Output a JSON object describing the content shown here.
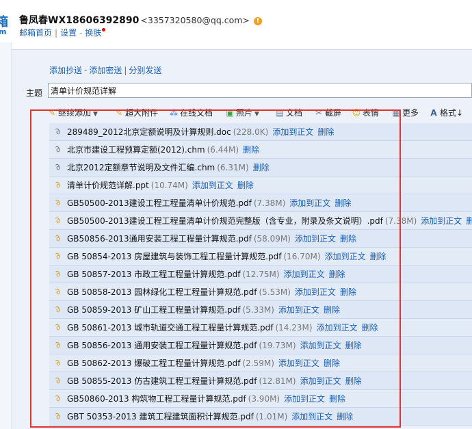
{
  "header": {
    "logo_fragment_top": "箱",
    "logo_fragment_bottom": "m",
    "user_name": "鲁凤春WX18606392890",
    "user_email": "<3357320580@qq.com>",
    "warn_symbol": "!",
    "nav": {
      "home": "邮箱首页",
      "settings": "设置",
      "sep": "-",
      "skin": "换肤"
    }
  },
  "compose": {
    "add_cc": "添加抄送",
    "add_bcc": "添加密送",
    "separate_send": "分别发送",
    "dash": "-",
    "pipe": "|",
    "subject_label": "主题",
    "subject_value": "清单计价规范详解"
  },
  "toolbar": {
    "items": [
      {
        "label": "继续添加",
        "icon": "paperclip-icon"
      },
      {
        "label": "超大附件",
        "icon": "paperclip-icon"
      },
      {
        "label": "在线文档",
        "icon": "share-icon"
      },
      {
        "label": "照片",
        "icon": "photo-icon"
      },
      {
        "label": "文档",
        "icon": "document-icon"
      },
      {
        "label": "截屏",
        "icon": "screenshot-icon"
      },
      {
        "label": "表情",
        "icon": "smiley-icon"
      },
      {
        "label": "更多",
        "icon": "grid-icon"
      },
      {
        "label": "格式↓",
        "icon": "font-icon"
      }
    ]
  },
  "attachment_actions": {
    "insert": "添加到正文",
    "delete": "删除"
  },
  "attachments": [
    {
      "name": "289489_2012北京定额说明及计算规则.doc",
      "size": "(228.0K)",
      "clip": "gray",
      "insert": true
    },
    {
      "name": "北京市建设工程预算定额(2012).chm",
      "size": "(6.44M)",
      "clip": "gray",
      "insert": false
    },
    {
      "name": "北京2012定额章节说明及文件汇编.chm",
      "size": "(6.31M)",
      "clip": "gray",
      "insert": false
    },
    {
      "name": "清单计价规范详解.ppt",
      "size": "(10.74M)",
      "clip": "gold",
      "insert": true
    },
    {
      "name": "GB50500-2013建设工程工程量清单计价规范.pdf",
      "size": "(7.38M)",
      "clip": "gold",
      "insert": true
    },
    {
      "name": "GB50500-2013建设工程工程量清单计价规范完整版（含专业，附录及条文说明）.pdf",
      "size": "(7.38M)",
      "clip": "gold",
      "insert": true
    },
    {
      "name": "GB50856-2013通用安装工程工程量计算规范.pdf",
      "size": "(58.09M)",
      "clip": "gold",
      "insert": true
    },
    {
      "name": "GB 50854-2013 房屋建筑与装饰工程工程量计算规范.pdf",
      "size": "(16.70M)",
      "clip": "gold",
      "insert": true
    },
    {
      "name": "GB 50857-2013 市政工程工程量计算规范.pdf",
      "size": "(12.75M)",
      "clip": "gold",
      "insert": true
    },
    {
      "name": "GB 50858-2013 园林绿化工程工程量计算规范.pdf",
      "size": "(5.53M)",
      "clip": "gold",
      "insert": true
    },
    {
      "name": "GB 50859-2013 矿山工程工程量计算规范.pdf",
      "size": "(5.33M)",
      "clip": "gold",
      "insert": true
    },
    {
      "name": "GB 50861-2013 城市轨道交通工程工程量计算规范.pdf",
      "size": "(14.23M)",
      "clip": "gold",
      "insert": true
    },
    {
      "name": "GB 50856-2013 通用安装工程工程量计算规范.pdf",
      "size": "(19.73M)",
      "clip": "gold",
      "insert": true
    },
    {
      "name": "GB 50862-2013 爆破工程工程量计算规范.pdf",
      "size": "(2.59M)",
      "clip": "gold",
      "insert": true
    },
    {
      "name": "GB 50855-2013 仿古建筑工程工程量计算规范.pdf",
      "size": "(12.81M)",
      "clip": "gold",
      "insert": true
    },
    {
      "name": "GB50860-2013 构筑物工程工程量计算规范.pdf",
      "size": "(3.90M)",
      "clip": "gold",
      "insert": true
    },
    {
      "name": "GBT 50353-2013 建筑工程建筑面积计算规范.pdf",
      "size": "(1.01M)",
      "clip": "gold",
      "insert": true
    }
  ],
  "colors": {
    "link": "#1a5fb4",
    "highlight": "#e5322d",
    "row_bg": "#dde7f5"
  }
}
